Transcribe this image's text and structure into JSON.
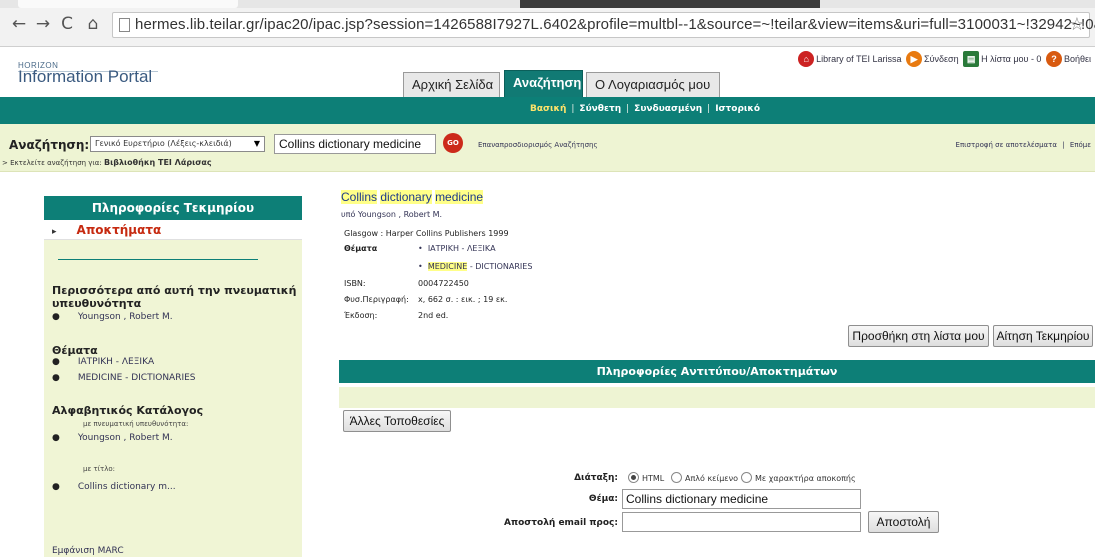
{
  "browser": {
    "url": "hermes.lib.teilar.gr/ipac20/ipac.jsp?session=1426588I7927L.6402&profile=multbl--1&source=~!teilar&view=items&uri=full=3100031~!32942~!0&ri=1"
  },
  "header": {
    "logo_small": "HORIZON",
    "logo_main": "Information Portal",
    "top_links": {
      "library": "Library of TEI Larissa",
      "login": "Σύνδεση",
      "my_list": "Η λίστα μου - 0",
      "help": "Βοήθει"
    },
    "tabs": [
      {
        "label": "Αρχική Σελίδα"
      },
      {
        "label": "Αναζήτηση"
      },
      {
        "label": "Ο Λογαριασμός μου"
      }
    ]
  },
  "subnav": {
    "items": [
      {
        "label": "Βασική"
      },
      {
        "label": "Σύνθετη"
      },
      {
        "label": "Συνδυασμένη"
      },
      {
        "label": "Ιστορικό"
      }
    ]
  },
  "search": {
    "label": "Αναζήτηση:",
    "index_selected": "Γενικό Ευρετήριο (Λέξεις-κλειδιά)",
    "query": "Collins dictionary medicine",
    "go_label": "GO",
    "refine_link": "Επαναπροσδιορισμός Αναζήτησης",
    "note_prefix": "> Εκτελείτε αναζήτηση για:",
    "note_library": "Βιβλιοθήκη ΤΕΙ Λάρισας",
    "back_to_results": "Επιστροφή σε αποτελέσματα",
    "next": "Επόμε"
  },
  "sidebar": {
    "heading": "Πληροφορίες Τεκμηρίου",
    "active_item": "Αποκτήματα",
    "more_by_author_title_1": "Περισσότερα από αυτή την πνευματική",
    "more_by_author_title_2": "υπευθυνότητα",
    "more_by_author_link": "Youngson , Robert M.",
    "subjects_title": "Θέματα",
    "subjects": [
      "ΙΑΤΡΙΚΗ - ΛΕΞΙΚΑ",
      "MEDICINE - DICTIONARIES"
    ],
    "alpha_title": "Αλφαβητικός Κατάλογος",
    "alpha_author_sub": "με πνευματική υπευθυνότητα:",
    "alpha_author_link": "Youngson , Robert M.",
    "alpha_title_sub": "με τίτλο:",
    "alpha_title_link": "Collins dictionary m...",
    "marc": "Εμφάνιση MARC"
  },
  "record": {
    "title_words": [
      "Collins",
      "dictionary",
      "medicine"
    ],
    "author": "υπό Youngson , Robert M.",
    "publication": "Glasgow : Harper Collins Publishers 1999",
    "subjects_label": "Θέματα",
    "subject_1": "ΙΑΤΡΙΚΗ - ΛΕΞΙΚΑ",
    "subject_2_hl": "MEDICINE",
    "subject_2_rest": " - DICTIONARIES",
    "isbn_label": "ISBN:",
    "isbn": "0004722450",
    "physical_label": "Φυσ.Περιγραφή:",
    "physical": "x, 662 σ. : εικ. ; 19 εκ.",
    "edition_label": "Έκδοση:",
    "edition": "2nd ed."
  },
  "actions": {
    "add_to_list": "Προσθήκη στη λίστα μου",
    "request_item": "Αίτηση Τεκμηρίου"
  },
  "copies": {
    "heading": "Πληροφορίες Αντιτύπου/Αποκτημάτων",
    "other_locations": "Άλλες Τοποθεσίες"
  },
  "email_form": {
    "format_label": "Διάταξη:",
    "format_options": [
      "HTML",
      "Απλό κείμενο",
      "Με χαρακτήρα αποκοπής"
    ],
    "format_selected": "HTML",
    "subject_label": "Θέμα:",
    "subject_value": "Collins dictionary medicine",
    "email_label": "Αποστολή email προς:",
    "email_value": "",
    "send_label": "Αποστολή"
  },
  "colors": {
    "teal": "#0d7f77",
    "light_green": "#eef4d3",
    "highlight": "#ffff88",
    "accent_red": "#cc2a1a"
  }
}
